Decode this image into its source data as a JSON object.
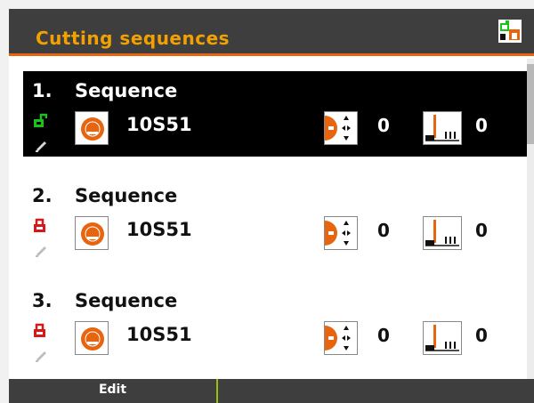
{
  "header": {
    "title": "Cutting sequences",
    "icon": "sequence-settings-icon"
  },
  "colors": {
    "accent": "#e8650f",
    "title": "#f2a100",
    "unlocked": "#19c419",
    "locked": "#d81818",
    "softkey_divider": "#9bbe12"
  },
  "sequences": [
    {
      "number": "1.",
      "name": "Sequence",
      "code": "10S51",
      "offset_value": "0",
      "measure_value": "0",
      "locked": false,
      "selected": true
    },
    {
      "number": "2.",
      "name": "Sequence",
      "code": "10S51",
      "offset_value": "0",
      "measure_value": "0",
      "locked": true,
      "selected": false
    },
    {
      "number": "3.",
      "name": "Sequence",
      "code": "10S51",
      "offset_value": "0",
      "measure_value": "0",
      "locked": true,
      "selected": false
    }
  ],
  "footer": {
    "softkey_1": "Edit"
  }
}
